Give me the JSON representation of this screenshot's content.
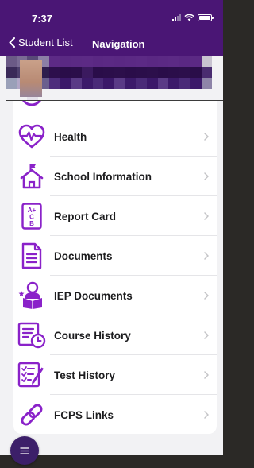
{
  "status_bar": {
    "time": "7:37"
  },
  "nav": {
    "back_label": "Student List",
    "title": "Navigation"
  },
  "menu": {
    "items": [
      {
        "label": "Health",
        "icon": "heart-pulse-icon"
      },
      {
        "label": "School Information",
        "icon": "school-house-icon"
      },
      {
        "label": "Report Card",
        "icon": "report-card-icon"
      },
      {
        "label": "Documents",
        "icon": "document-icon"
      },
      {
        "label": "IEP Documents",
        "icon": "iep-reader-icon"
      },
      {
        "label": "Course History",
        "icon": "course-history-icon"
      },
      {
        "label": "Test History",
        "icon": "test-checklist-icon"
      },
      {
        "label": "FCPS Links",
        "icon": "link-icon"
      }
    ]
  },
  "colors": {
    "brand": "#4a1675",
    "icon": "#8a22c9",
    "fab": "#3c1f69"
  }
}
